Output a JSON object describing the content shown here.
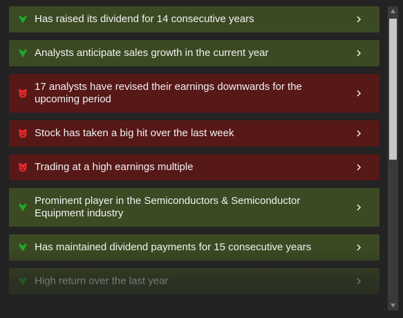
{
  "items": [
    {
      "type": "bull",
      "text": "Has raised its dividend for 14 consecutive years",
      "icon": "bull-icon"
    },
    {
      "type": "bull",
      "text": "Analysts anticipate sales growth in the current year",
      "icon": "bull-icon"
    },
    {
      "type": "bear",
      "text": "17 analysts have revised their earnings downwards for the upcoming period",
      "icon": "bear-icon"
    },
    {
      "type": "bear",
      "text": "Stock has taken a big hit over the last week",
      "icon": "bear-icon"
    },
    {
      "type": "bear",
      "text": "Trading at a high earnings multiple",
      "icon": "bear-icon"
    },
    {
      "type": "bull",
      "text": "Prominent player in the Semiconductors & Semiconductor Equipment industry",
      "icon": "bull-icon"
    },
    {
      "type": "bull",
      "text": "Has maintained dividend payments for 15 consecutive years",
      "icon": "bull-icon"
    },
    {
      "type": "bull",
      "text": "High return over the last year",
      "icon": "bull-icon"
    }
  ],
  "chevron_icon": "chevron-right-icon",
  "colors": {
    "bull_background": "#3b4a22",
    "bear_background": "#571818",
    "bull_icon": "#1fa82a",
    "bear_icon": "#e0282a",
    "text": "#f2f2f2",
    "page_background": "#232323"
  }
}
